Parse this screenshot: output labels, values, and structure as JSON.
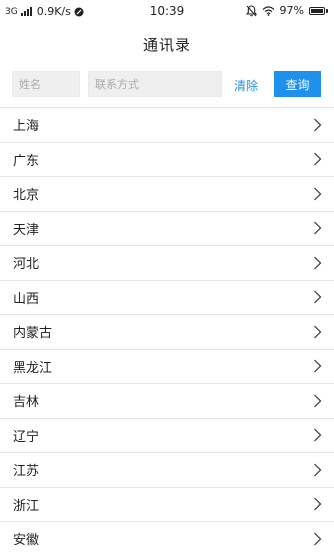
{
  "status_bar": {
    "network_type": "3G",
    "speed": "0.9K/s",
    "time": "10:39",
    "battery": "97%",
    "battery_level": 0.97
  },
  "header": {
    "title": "通讯录"
  },
  "search": {
    "name_placeholder": "姓名",
    "contact_placeholder": "联系方式",
    "clear_label": "清除",
    "query_label": "查询"
  },
  "regions": [
    {
      "label": "上海"
    },
    {
      "label": "广东"
    },
    {
      "label": "北京"
    },
    {
      "label": "天津"
    },
    {
      "label": "河北"
    },
    {
      "label": "山西"
    },
    {
      "label": "内蒙古"
    },
    {
      "label": "黑龙江"
    },
    {
      "label": "吉林"
    },
    {
      "label": "辽宁"
    },
    {
      "label": "江苏"
    },
    {
      "label": "浙江"
    },
    {
      "label": "安徽"
    }
  ],
  "colors": {
    "accent": "#1e90ee",
    "link": "#2a8fd8",
    "divider": "#e5e5e5"
  }
}
